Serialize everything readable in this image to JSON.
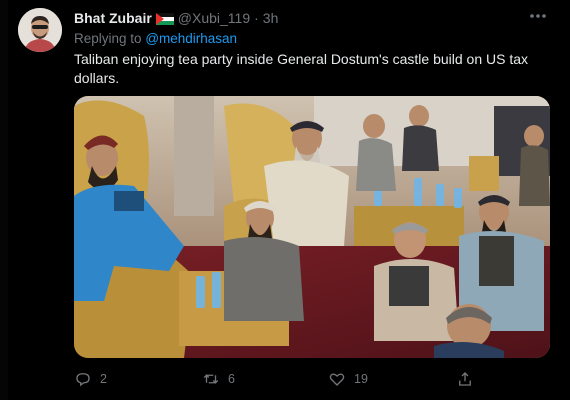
{
  "tweet": {
    "author_name": "Bhat Zubair",
    "flag_icon": "palestine-flag-icon",
    "handle": "@Xubi_119",
    "separator": "·",
    "time": "3h",
    "more_icon": "more-dots-icon",
    "replying_to_label": "Replying to",
    "replying_to_handle": "@mehdirhasan",
    "text": "Taliban enjoying tea party inside General Dostum's castle build on US tax dollars.",
    "media_alt": "video-frame"
  },
  "actions": {
    "reply_count": "2",
    "retweet_count": "6",
    "like_count": "19",
    "reply_icon": "reply-icon",
    "retweet_icon": "retweet-icon",
    "like_icon": "heart-icon",
    "share_icon": "share-icon"
  },
  "colors": {
    "background": "#000000",
    "text": "#e7e9ea",
    "muted": "#71767b",
    "accent": "#1d9bf0"
  }
}
